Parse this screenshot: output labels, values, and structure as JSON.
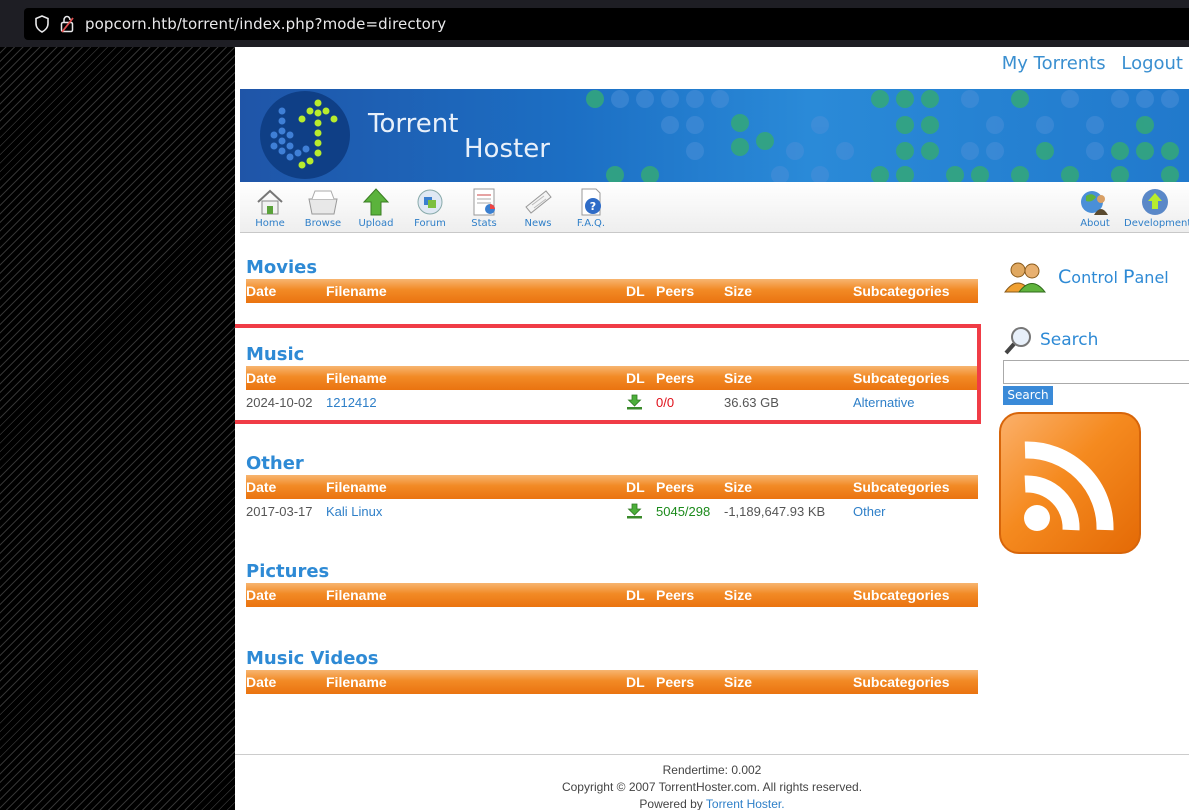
{
  "browser": {
    "url": "popcorn.htb/torrent/index.php?mode=directory"
  },
  "header": {
    "my_torrents": "My Torrents",
    "logout": "Logout",
    "site_title_line1": "Torrent",
    "site_title_line2": "Hoster"
  },
  "nav": {
    "home": "Home",
    "browse": "Browse",
    "upload": "Upload",
    "forum": "Forum",
    "stats": "Stats",
    "news": "News",
    "faq": "F.A.Q.",
    "about": "About",
    "development": "Development"
  },
  "columns": {
    "date": "Date",
    "filename": "Filename",
    "dl": "DL",
    "peers": "Peers",
    "size": "Size",
    "subcategories": "Subcategories"
  },
  "categories": [
    {
      "title": "Movies"
    },
    {
      "title": "Music",
      "rows": [
        {
          "date": "2024-10-02",
          "filename": "1212412",
          "peers": "0/0",
          "size": "36.63 GB",
          "subcategory": "Alternative"
        }
      ]
    },
    {
      "title": "Other",
      "rows": [
        {
          "date": "2017-03-17",
          "filename": "Kali Linux",
          "peers": "5045/298",
          "size": "-1,189,647.93 KB",
          "subcategory": "Other"
        }
      ]
    },
    {
      "title": "Pictures"
    },
    {
      "title": "Music Videos"
    }
  ],
  "colors": {
    "peers_dead": "#e0101a",
    "peers_alive": "#1b8a1b",
    "highlight_box": "#f03c46",
    "header_orange": "#f28a25",
    "link_blue": "#2e8ad5"
  },
  "sidebar": {
    "control_panel_c": "C",
    "control_panel_rest1": "ontrol ",
    "control_panel_p": "P",
    "control_panel_rest2": "anel",
    "search_title": "Search",
    "search_button": "Search",
    "rss_icon": "rss-feed-icon"
  },
  "footer": {
    "rendertime": "Rendertime: 0.002",
    "copyright": "Copyright © 2007 TorrentHoster.com. All rights reserved.",
    "powered_by": "Powered by ",
    "powered_link": "Torrent Hoster."
  }
}
